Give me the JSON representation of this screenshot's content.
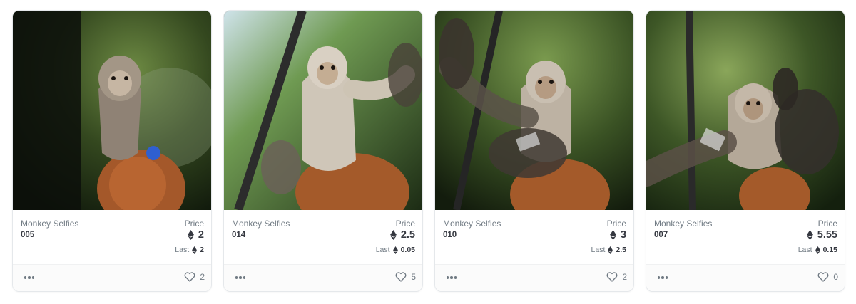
{
  "currency_icon": "ethereum-icon",
  "more_icon": "more-horizontal-icon",
  "favorite_icon": "heart-icon",
  "colors": {
    "text_primary": "#353840",
    "text_secondary": "#707a83",
    "border": "#e5e8eb"
  },
  "cards": [
    {
      "image": "monkey-selfie-photo",
      "collection": "Monkey Selfies",
      "token": "005",
      "price_label": "Price",
      "price": "2",
      "last_label": "Last",
      "last": "2",
      "favorites": "2"
    },
    {
      "image": "monkey-selfie-photo",
      "collection": "Monkey Selfies",
      "token": "014",
      "price_label": "Price",
      "price": "2.5",
      "last_label": "Last",
      "last": "0.05",
      "favorites": "5"
    },
    {
      "image": "monkey-selfie-photo",
      "collection": "Monkey Selfies",
      "token": "010",
      "price_label": "Price",
      "price": "3",
      "last_label": "Last",
      "last": "2.5",
      "favorites": "2"
    },
    {
      "image": "monkey-selfie-photo",
      "collection": "Monkey Selfies",
      "token": "007",
      "price_label": "Price",
      "price": "5.55",
      "last_label": "Last",
      "last": "0.15",
      "favorites": "0"
    }
  ]
}
